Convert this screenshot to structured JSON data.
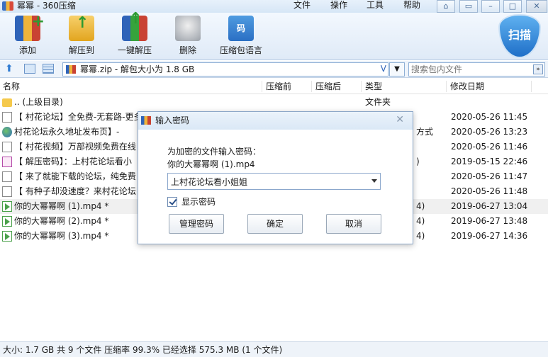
{
  "window": {
    "title": "幂幂 - 360压缩",
    "menu": [
      "文件",
      "操作",
      "工具",
      "帮助"
    ]
  },
  "toolbar": {
    "buttons": [
      {
        "label": "添加",
        "icon": "add-archive-icon"
      },
      {
        "label": "解压到",
        "icon": "extract-to-icon"
      },
      {
        "label": "一键解压",
        "icon": "one-click-extract-icon"
      },
      {
        "label": "删除",
        "icon": "delete-icon"
      },
      {
        "label": "压缩包语言",
        "icon": "archive-language-icon"
      }
    ],
    "scan_label": "扫描",
    "lang_glyph": "码"
  },
  "address": {
    "path": "幂幂.zip - 解包大小为 1.8 GB",
    "search_placeholder": "搜索包内文件"
  },
  "list": {
    "columns": [
      "名称",
      "压缩前",
      "压缩后",
      "类型",
      "修改日期"
    ],
    "rows": [
      {
        "name": ".. (上级目录)",
        "type": "文件夹",
        "date": "",
        "icon": "folder"
      },
      {
        "name": "【 村花论坛】全免费-无套路-更多",
        "type": "",
        "date": "2020-05-26 11:45",
        "icon": "txt"
      },
      {
        "name": "村花论坛永久地址发布页】-",
        "type": "方式",
        "date": "2020-05-26 13:23",
        "icon": "web"
      },
      {
        "name": "【 村花视频】万部视频免费在线",
        "type": "",
        "date": "2020-05-26 11:46",
        "icon": "txt"
      },
      {
        "name": "【 解压密码】：上村花论坛看小",
        "type": ")",
        "date": "2019-05-15 22:46",
        "icon": "img"
      },
      {
        "name": "【 来了就能下载的论坛，纯免费",
        "type": "",
        "date": "2020-05-26 11:47",
        "icon": "txt"
      },
      {
        "name": "【 有种子却没速度？来村花论坛",
        "type": "",
        "date": "2020-05-26 11:48",
        "icon": "txt"
      },
      {
        "name": "你的大幂幂啊 (1).mp4 *",
        "type": "4)",
        "date": "2019-06-27 13:04",
        "icon": "vid"
      },
      {
        "name": "你的大幂幂啊 (2).mp4 *",
        "type": "4)",
        "date": "2019-06-27 13:48",
        "icon": "vid"
      },
      {
        "name": "你的大幂幂啊 (3).mp4 *",
        "type": "4)",
        "date": "2019-06-27 14:36",
        "icon": "vid"
      }
    ]
  },
  "status": {
    "text": "大小: 1.7 GB 共 9 个文件 压缩率 99.3% 已经选择 575.3 MB (1 个文件)"
  },
  "dialog": {
    "title": "输入密码",
    "prompt": "为加密的文件输入密码：",
    "file": "你的大幂幂啊 (1).mp4",
    "password_value": "上村花论坛看小姐姐",
    "show_password_label": "显示密码",
    "show_password_checked": true,
    "buttons": {
      "manage": "管理密码",
      "ok": "确定",
      "cancel": "取消"
    }
  }
}
